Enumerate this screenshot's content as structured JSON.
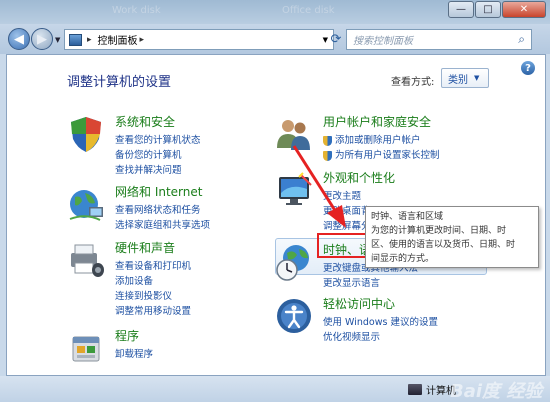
{
  "window": {
    "bg_left_text": "Work disk",
    "bg_right_text": "Office disk",
    "controls": {
      "minimize": "—",
      "maximize": "□",
      "close": "✕"
    }
  },
  "toolbar": {
    "breadcrumb": "控制面板",
    "search_placeholder": "搜索控制面板"
  },
  "header": {
    "title": "调整计算机的设置",
    "view_by_label": "查看方式:",
    "view_by_value": "类别"
  },
  "categories": [
    {
      "title": "系统和安全",
      "icon": "system-security-icon",
      "links": [
        "查看您的计算机状态",
        "备份您的计算机",
        "查找并解决问题"
      ]
    },
    {
      "title": "网络和 Internet",
      "icon": "network-icon",
      "links": [
        "查看网络状态和任务",
        "选择家庭组和共享选项"
      ]
    },
    {
      "title": "硬件和声音",
      "icon": "hardware-sound-icon",
      "links": [
        "查看设备和打印机",
        "添加设备",
        "连接到投影仪",
        "调整常用移动设置"
      ]
    },
    {
      "title": "程序",
      "icon": "programs-icon",
      "links": [
        "卸载程序"
      ]
    },
    {
      "title": "用户帐户和家庭安全",
      "icon": "user-accounts-icon",
      "links": [
        "添加或删除用户帐户",
        "为所有用户设置家长控制"
      ]
    },
    {
      "title": "外观和个性化",
      "icon": "appearance-icon",
      "links": [
        "更改主题",
        "更改桌面背景",
        "调整屏幕分辨率"
      ]
    },
    {
      "title": "时钟、语言和区域",
      "icon": "clock-region-icon",
      "links": [
        "更改键盘或其他输入法",
        "更改显示语言"
      ]
    },
    {
      "title": "轻松访问中心",
      "icon": "ease-of-access-icon",
      "links": [
        "使用 Windows 建议的设置",
        "优化视频显示"
      ]
    }
  ],
  "tooltip": {
    "lines": [
      "时钟、语言和区域",
      "为您的计算机更改时间、日期、时",
      "区、使用的语言以及货币、日期、时",
      "间显示的方式。"
    ]
  },
  "statusbar": {
    "computer_label": "计算机"
  },
  "watermark": "Bai度 经验",
  "colors": {
    "category_title": "#1a7d1a",
    "link": "#1e50a2",
    "highlight_box": "#e52222"
  }
}
